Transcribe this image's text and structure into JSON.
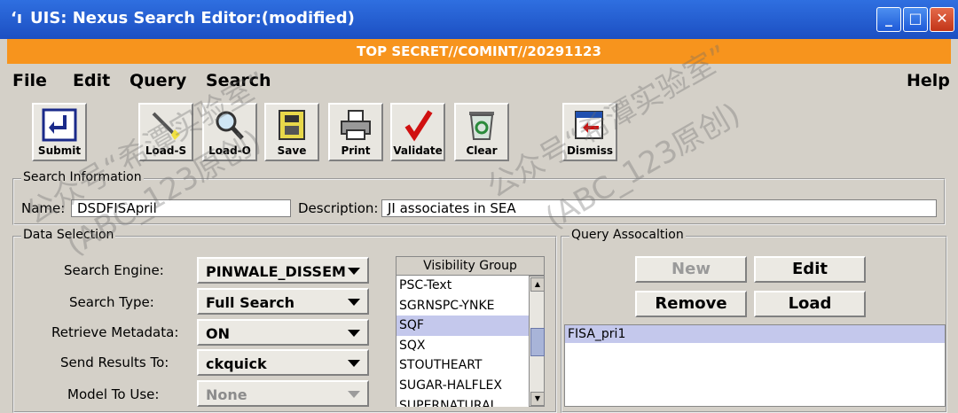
{
  "window": {
    "title": "UIS: Nexus Search Editor:(modified)",
    "title_icon": "‘ı",
    "controls": {
      "minimize": "_",
      "maximize": "□",
      "close": "✕"
    }
  },
  "banner": {
    "text": "TOP SECRET//COMINT//20291123",
    "color": "#f7941d"
  },
  "menu": {
    "file": "File",
    "edit": "Edit",
    "query": "Query",
    "search": "Search",
    "help": "Help"
  },
  "toolbar": {
    "submit": "Submit",
    "load_s": "Load-S",
    "load_o": "Load-O",
    "save": "Save",
    "print": "Print",
    "validate": "Validate",
    "clear": "Clear",
    "dismiss": "Dismiss"
  },
  "search_info": {
    "title": "Search Information",
    "name_label": "Name:",
    "name_value": "DSDFISApril",
    "description_label": "Description:",
    "description_value": "JI associates in SEA"
  },
  "data_selection": {
    "title": "Data Selection",
    "search_engine_label": "Search Engine:",
    "search_engine_value": "PINWALE_DISSEM",
    "search_type_label": "Search Type:",
    "search_type_value": "Full Search",
    "retrieve_metadata_label": "Retrieve Metadata:",
    "retrieve_metadata_value": "ON",
    "send_results_label": "Send Results To:",
    "send_results_value": "ckquick",
    "model_label": "Model To Use:",
    "model_value": "None"
  },
  "visibility_group": {
    "header": "Visibility Group",
    "items": [
      "PSC-Text",
      "SGRNSPC-YNKE",
      "SQF",
      "SQX",
      "STOUTHEART",
      "SUGAR-HALFLEX",
      "SUPERNATURAL"
    ],
    "selected": "SQF"
  },
  "query_association": {
    "title": "Query Assocaltion",
    "new": "New",
    "edit": "Edit",
    "remove": "Remove",
    "load": "Load",
    "items": [
      "FISA_pri1"
    ]
  },
  "watermark": {
    "line1": "公众号“希潭实验室”",
    "line2": "(ABC_123原创)"
  }
}
